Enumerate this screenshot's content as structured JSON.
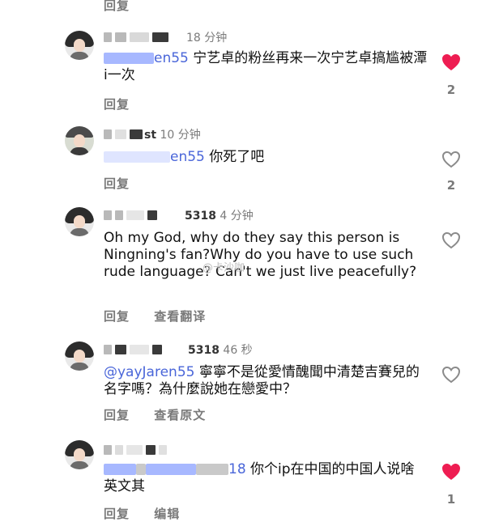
{
  "top_reply_label": "回复",
  "colors": {
    "mention": "#4a66d9",
    "heart_liked": "#ee1d52",
    "heart_outline": "#888888",
    "muted": "#7a7a7a"
  },
  "watermark": "@卡沙咖",
  "comments": [
    {
      "time": "18 分钟",
      "avatar_icon": "user-avatar-icon",
      "mention": "en55",
      "text": "宁艺卓的粉丝再来一次宁艺卓搞尴被潭i一次",
      "actions": [
        "回复"
      ],
      "liked": true,
      "likes": "2"
    },
    {
      "time": "10 分钟",
      "name_fragment": "st",
      "avatar_icon": "user-avatar-icon",
      "mention": "en55",
      "text": "你死了吧",
      "actions": [
        "回复"
      ],
      "liked": false,
      "likes": "2"
    },
    {
      "id_fragment": "5318",
      "time": "4 分钟",
      "avatar_icon": "user-avatar-icon",
      "text": "Oh my God, why do they say this person is Ningning's fan?Why do you have to use such rude language? Can't we just live peacefully?",
      "actions": [
        "回复",
        "查看翻译"
      ],
      "liked": false,
      "likes": ""
    },
    {
      "id_fragment": "5318",
      "time": "46 秒",
      "avatar_icon": "user-avatar-icon",
      "mention": "@yayJaren55",
      "text": "寧寧不是從愛情醜聞中清楚吉賽兒的名字嗎？為什麼說她在戀愛中？",
      "actions": [
        "回复",
        "查看原文"
      ],
      "liked": false,
      "likes": ""
    },
    {
      "time": "",
      "avatar_icon": "user-avatar-icon",
      "mention_suffix": "18",
      "text": "你个ip在中国的中国人说啥英文其",
      "actions": [
        "回复",
        "编辑"
      ],
      "liked": true,
      "likes": "1"
    }
  ]
}
